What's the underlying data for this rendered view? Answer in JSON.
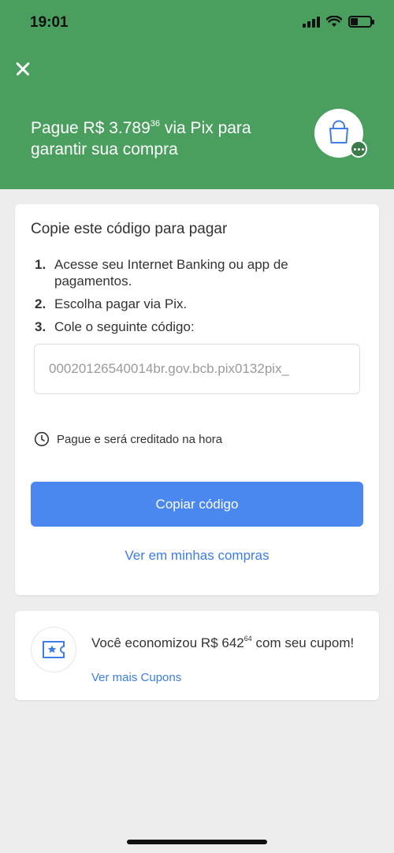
{
  "status_bar": {
    "time": "19:01"
  },
  "header": {
    "title_prefix": "Pague R$ 3.789",
    "title_cents": "36",
    "title_suffix": " via Pix para garantir sua compra"
  },
  "payment_card": {
    "title": "Copie este código para pagar",
    "steps": [
      {
        "num": "1.",
        "text": "Acesse seu Internet Banking ou app de pagamentos."
      },
      {
        "num": "2.",
        "text": "Escolha pagar via Pix."
      },
      {
        "num": "3.",
        "text": "Cole o seguinte código:"
      }
    ],
    "pix_code": "00020126540014br.gov.bcb.pix0132pix_",
    "note": "Pague e será creditado na hora",
    "copy_button": "Copiar código",
    "purchases_link": "Ver em minhas compras"
  },
  "coupon_card": {
    "text_prefix": "Você economizou R$ 642",
    "text_cents": "64",
    "text_suffix": " com seu cupom!",
    "link": "Ver mais Cupons"
  },
  "colors": {
    "header_green": "#4a9f5e",
    "primary_blue": "#4a87ee",
    "link_blue": "#3b7ce9",
    "icon_blue": "#3f7de8"
  }
}
